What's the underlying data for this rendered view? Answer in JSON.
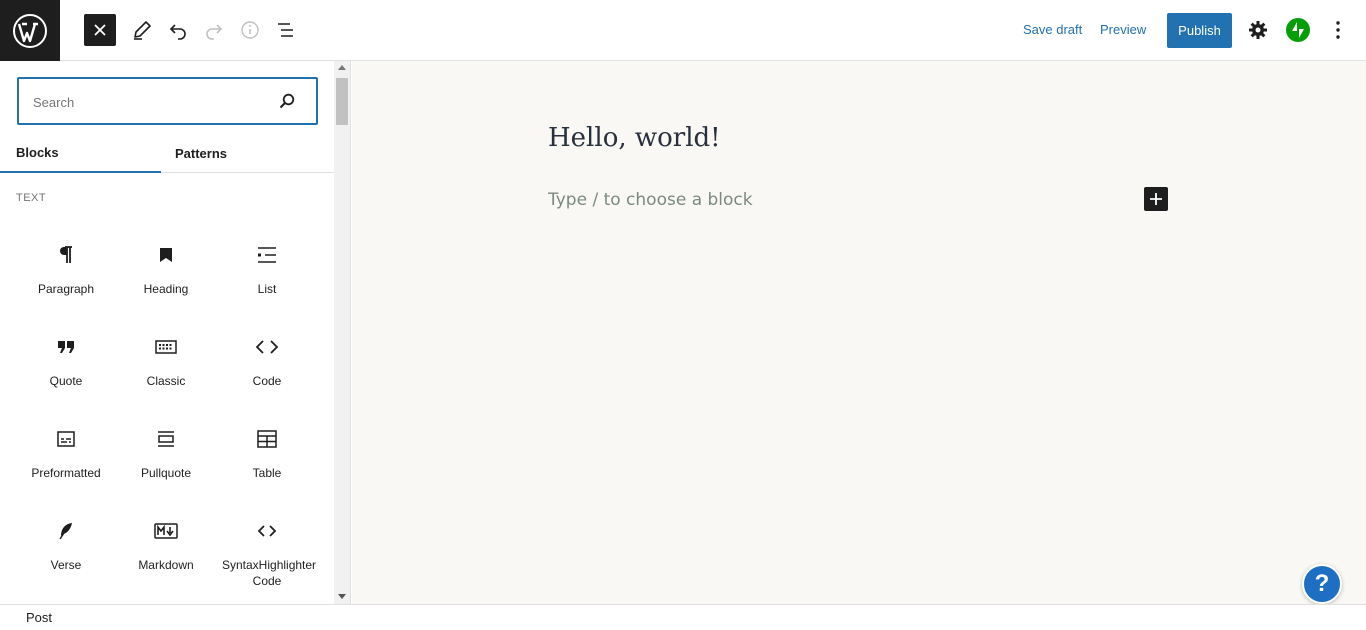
{
  "toolbar": {
    "save_draft_label": "Save draft",
    "preview_label": "Preview",
    "publish_label": "Publish",
    "icons": {
      "logo": "wordpress-logo-icon",
      "close": "close-icon",
      "edit": "pencil-icon",
      "undo": "undo-icon",
      "redo": "redo-icon",
      "info": "info-icon",
      "outline": "list-view-icon",
      "settings": "gear-icon",
      "jetpack": "jetpack-icon",
      "more": "more-vertical-icon"
    },
    "colors": {
      "accent": "#2271b1",
      "jetpack": "#069e08"
    }
  },
  "inserter": {
    "search_placeholder": "Search",
    "tabs": [
      "Blocks",
      "Patterns"
    ],
    "category": "TEXT",
    "blocks": [
      {
        "label": "Paragraph",
        "icon": "paragraph-icon"
      },
      {
        "label": "Heading",
        "icon": "heading-icon"
      },
      {
        "label": "List",
        "icon": "list-icon"
      },
      {
        "label": "Quote",
        "icon": "quote-icon"
      },
      {
        "label": "Classic",
        "icon": "keyboard-icon"
      },
      {
        "label": "Code",
        "icon": "code-icon"
      },
      {
        "label": "Preformatted",
        "icon": "preformatted-icon"
      },
      {
        "label": "Pullquote",
        "icon": "pullquote-icon"
      },
      {
        "label": "Table",
        "icon": "table-icon"
      },
      {
        "label": "Verse",
        "icon": "verse-icon"
      },
      {
        "label": "Markdown",
        "icon": "markdown-icon"
      },
      {
        "label": "SyntaxHighlighter Code",
        "icon": "code-icon"
      }
    ]
  },
  "editor": {
    "title": "Hello, world!",
    "block_placeholder": "Type / to choose a block",
    "help_label": "?",
    "background": "#f9f8f4"
  },
  "footer": {
    "breadcrumb": "Post"
  }
}
